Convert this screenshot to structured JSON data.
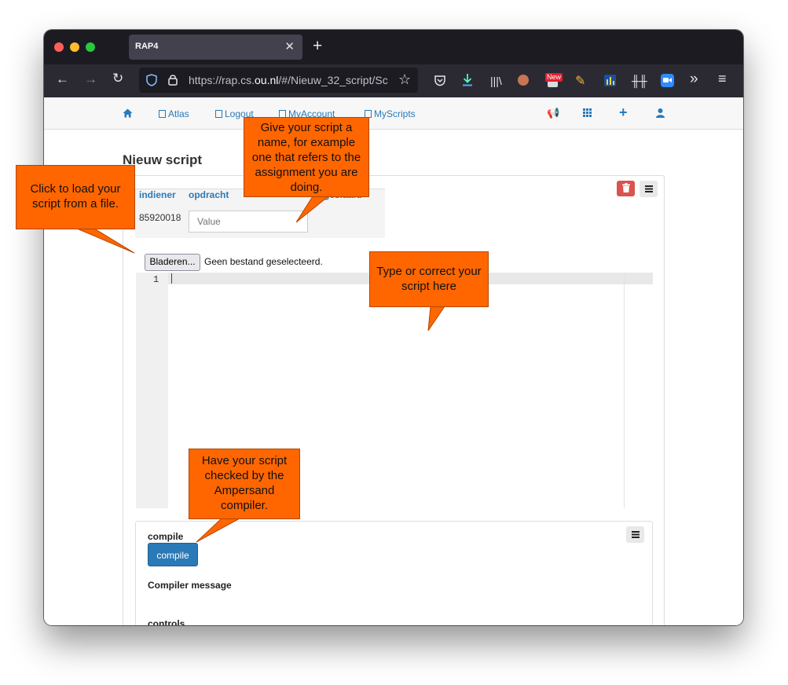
{
  "browser": {
    "tab_title": "RAP4",
    "tab_close": "✕",
    "new_tab": "+",
    "url_prefix": "https://rap.cs.",
    "url_domain": "ou.nl",
    "url_rest": "/#/Nieuw_32_script/Sc",
    "new_badge": "New"
  },
  "site_nav": {
    "atlas": "Atlas",
    "logout": "Logout",
    "myaccount": "MyAccount",
    "myscripts": "MyScripts"
  },
  "page": {
    "title": "Nieuw script"
  },
  "script_panel": {
    "col_indiener": "indiener",
    "col_opdracht": "opdracht",
    "col_hidden_suffix": "...geslaafd",
    "indiener_value": "85920018",
    "value_placeholder": "Value",
    "browse_label": "Bladeren...",
    "no_file_label": "Geen bestand geselecteerd.",
    "line_number": "1"
  },
  "compile_panel": {
    "heading": "compile",
    "button_label": "compile",
    "compiler_message_label": "Compiler message",
    "controls_label": "controls"
  },
  "callouts": {
    "load_file": "Click to load your script from a file.",
    "name_script": "Give your script a name, for example one that refers to the assignment you are doing.",
    "type_script": "Type or correct your script here",
    "compile": "Have your script checked by the Ampersand compiler."
  },
  "colors": {
    "link_blue": "#2a7ab8",
    "callout_orange": "#ff6600",
    "danger_red": "#d9534f"
  }
}
